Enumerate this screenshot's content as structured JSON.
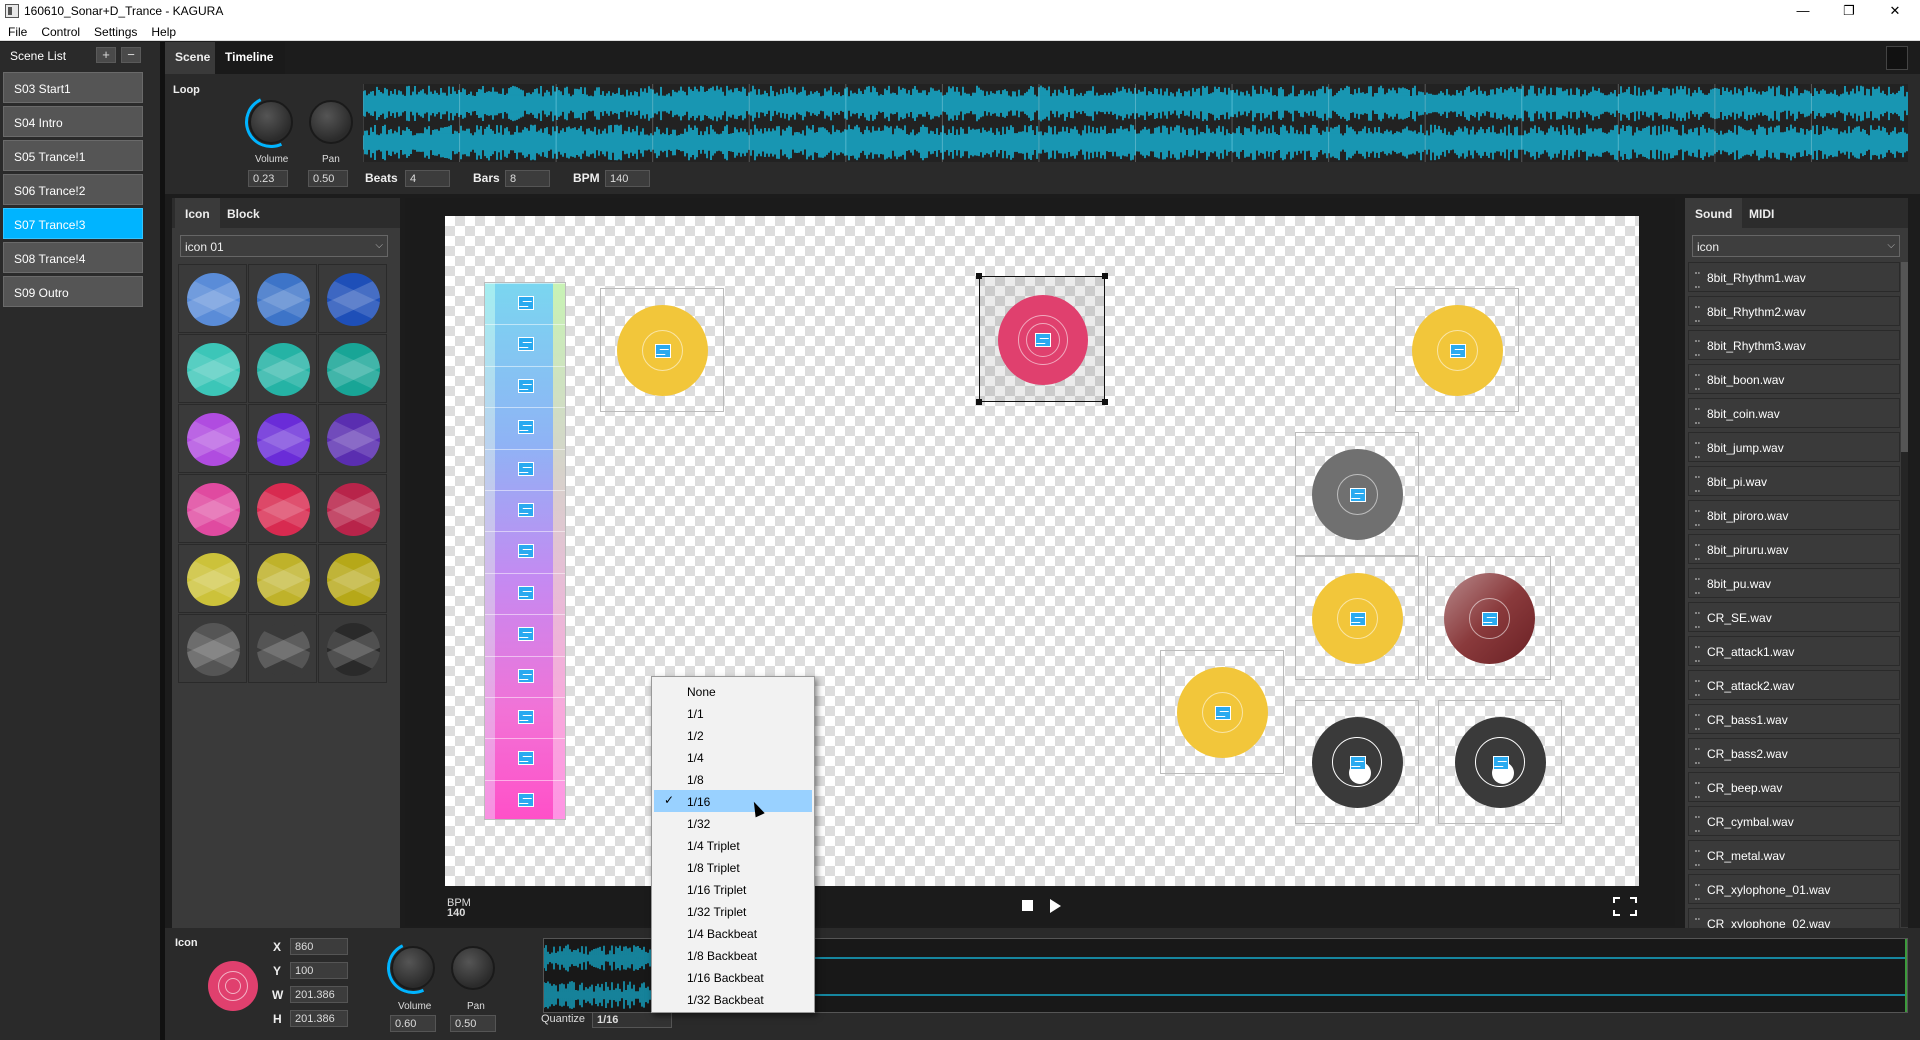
{
  "window": {
    "title": "160610_Sonar+D_Trance - KAGURA",
    "minimize_glyph": "—",
    "maximize_glyph": "❐",
    "close_glyph": "✕"
  },
  "menu": [
    "File",
    "Control",
    "Settings",
    "Help"
  ],
  "scene_list": {
    "title": "Scene List",
    "add": "+",
    "remove": "−",
    "items": [
      "S03 Start1",
      "S04 Intro",
      "S05 Trance!1",
      "S06 Trance!2",
      "S07 Trance!3",
      "S08 Trance!4",
      "S09 Outro"
    ],
    "active_index": 4
  },
  "main_tabs": [
    "Scene",
    "Timeline"
  ],
  "loop": {
    "label": "Loop",
    "volume_label": "Volume",
    "pan_label": "Pan",
    "volume": "0.23",
    "pan": "0.50",
    "beats_label": "Beats",
    "beats": "4",
    "bars_label": "Bars",
    "bars": "8",
    "bpm_label": "BPM",
    "bpm": "140"
  },
  "left_panel": {
    "tabs": [
      "Icon",
      "Block"
    ],
    "icon_select": "icon 01",
    "palette_colors": [
      [
        "#5a8cd8",
        "#3d74c8",
        "#1e4fb8"
      ],
      [
        "#3cc6b8",
        "#25b3a5",
        "#18a596"
      ],
      [
        "#b04ce0",
        "#6a2cd8",
        "#5a2eb0"
      ],
      [
        "#e04aa0",
        "#d82a50",
        "#b8244a"
      ],
      [
        "#ccc23a",
        "#bfb22a",
        "#b6a818"
      ],
      [
        "#555555",
        "#3a3a3a",
        "#2a2a2a"
      ]
    ]
  },
  "stage": {
    "bpm_label": "BPM",
    "bpm": "140"
  },
  "right_panel": {
    "tabs": [
      "Sound",
      "MIDI"
    ],
    "filter_select": "icon",
    "sounds": [
      "8bit_Rhythm1.wav",
      "8bit_Rhythm2.wav",
      "8bit_Rhythm3.wav",
      "8bit_boon.wav",
      "8bit_coin.wav",
      "8bit_jump.wav",
      "8bit_pi.wav",
      "8bit_piroro.wav",
      "8bit_piruru.wav",
      "8bit_pu.wav",
      "CR_SE.wav",
      "CR_attack1.wav",
      "CR_attack2.wav",
      "CR_bass1.wav",
      "CR_bass2.wav",
      "CR_beep.wav",
      "CR_cymbal.wav",
      "CR_metal.wav",
      "CR_xylophone_01.wav",
      "CR_xylophone_02.wav"
    ]
  },
  "inspector": {
    "title": "Icon",
    "x_label": "X",
    "x": "860",
    "y_label": "Y",
    "y": "100",
    "w_label": "W",
    "w": "201.386",
    "h_label": "H",
    "h": "201.386",
    "volume_label": "Volume",
    "volume": "0.60",
    "pan_label": "Pan",
    "pan": "0.50",
    "quantize_label": "Quantize",
    "quantize": "1/16"
  },
  "quantize_menu": {
    "items": [
      "None",
      "1/1",
      "1/2",
      "1/4",
      "1/8",
      "1/16",
      "1/32",
      "1/4  Triplet",
      "1/8  Triplet",
      "1/16 Triplet",
      "1/32 Triplet",
      "1/4  Backbeat",
      "1/8  Backbeat",
      "1/16 Backbeat",
      "1/32 Backbeat"
    ],
    "checked_index": 5,
    "check_glyph": "✓"
  },
  "colors": {
    "accent": "#00b4ff",
    "waveform": "#14c8f0",
    "selected_disc": "#e0406e",
    "yellow_disc": "#f2c63a",
    "gray_disc": "#707070",
    "dark_disc": "#3a3a3a",
    "maroon_disc": "#8a3a3c"
  }
}
